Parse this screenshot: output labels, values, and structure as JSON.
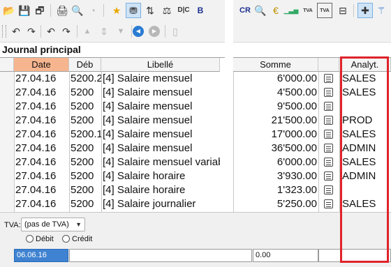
{
  "toolbar_row1": [
    {
      "icon": "open-folder-icon",
      "glyph": "📂"
    },
    {
      "icon": "save-icon",
      "glyph": "💾"
    },
    {
      "icon": "save-close-icon",
      "glyph": "🗗"
    },
    {
      "icon": "print-icon",
      "glyph": "🖨"
    },
    {
      "icon": "print-preview-icon",
      "glyph": "🔍"
    },
    {
      "icon": "clock-icon",
      "glyph": "◔"
    },
    {
      "icon": "star-icon",
      "glyph": "★"
    },
    {
      "icon": "filter-icon",
      "glyph": "⛃"
    },
    {
      "icon": "sort-icon",
      "glyph": "⇅"
    },
    {
      "icon": "balance-icon",
      "glyph": "⚖"
    },
    {
      "icon": "dc-icon",
      "glyph": "D|C"
    },
    {
      "icon": "bold-icon",
      "glyph": "B"
    },
    {
      "icon": "cr-icon",
      "glyph": "CR"
    },
    {
      "icon": "search-icon",
      "glyph": "🔍"
    },
    {
      "icon": "euro-icon",
      "glyph": "€"
    },
    {
      "icon": "bar-chart-icon",
      "glyph": "▁▃▅"
    },
    {
      "icon": "vat-icon",
      "glyph": "TVA"
    },
    {
      "icon": "vat-box-icon",
      "glyph": "TVA"
    },
    {
      "icon": "structure-icon",
      "glyph": "⊟"
    },
    {
      "icon": "add-icon",
      "glyph": "✚"
    },
    {
      "icon": "wand-icon",
      "glyph": "⚚"
    },
    {
      "icon": "pencil-icon",
      "glyph": "✎"
    }
  ],
  "toolbar_row2": [
    {
      "icon": "undo-icon",
      "glyph": "↶"
    },
    {
      "icon": "redo-icon",
      "glyph": "↷"
    },
    {
      "icon": "undo-list-icon",
      "glyph": "↶"
    },
    {
      "icon": "redo-list-icon",
      "glyph": "↷"
    },
    {
      "icon": "move-up-icon",
      "glyph": "▲"
    },
    {
      "icon": "move-both-icon",
      "glyph": "⇕"
    },
    {
      "icon": "move-down-icon",
      "glyph": "▼"
    },
    {
      "icon": "back-icon",
      "glyph": "◀"
    },
    {
      "icon": "forward-icon",
      "glyph": "▶"
    },
    {
      "icon": "info-icon",
      "glyph": "▯"
    }
  ],
  "journal": {
    "title": "Journal principal",
    "columns": {
      "date": "Date",
      "debit": "Déb",
      "label": "Libellé",
      "amount": "Somme",
      "analytic": "Analyt."
    },
    "rows": [
      {
        "date": "27.04.16",
        "debit": "5200.2",
        "label": "[4] Salaire mensuel",
        "amount": "6'000.00",
        "analytic": "SALES"
      },
      {
        "date": "27.04.16",
        "debit": "5200",
        "label": "[4] Salaire mensuel",
        "amount": "4'500.00",
        "analytic": "SALES"
      },
      {
        "date": "27.04.16",
        "debit": "5200",
        "label": "[4] Salaire mensuel",
        "amount": "9'500.00",
        "analytic": ""
      },
      {
        "date": "27.04.16",
        "debit": "5200",
        "label": "[4] Salaire mensuel",
        "amount": "21'500.00",
        "analytic": "PROD"
      },
      {
        "date": "27.04.16",
        "debit": "5200.1",
        "label": "[4] Salaire mensuel",
        "amount": "17'000.00",
        "analytic": "SALES"
      },
      {
        "date": "27.04.16",
        "debit": "5200",
        "label": "[4] Salaire mensuel",
        "amount": "36'500.00",
        "analytic": "ADMIN"
      },
      {
        "date": "27.04.16",
        "debit": "5200",
        "label": "[4] Salaire mensuel variab",
        "amount": "6'000.00",
        "analytic": "SALES"
      },
      {
        "date": "27.04.16",
        "debit": "5200",
        "label": "[4] Salaire horaire",
        "amount": "3'930.00",
        "analytic": "ADMIN"
      },
      {
        "date": "27.04.16",
        "debit": "5200",
        "label": "[4] Salaire horaire",
        "amount": "1'323.00",
        "analytic": ""
      },
      {
        "date": "27.04.16",
        "debit": "5200",
        "label": "[4] Salaire journalier",
        "amount": "5'250.00",
        "analytic": "SALES"
      }
    ]
  },
  "entry_form": {
    "vat_label": "TVA:",
    "vat_value": "(pas de TVA)",
    "radio_debit": "Débit",
    "radio_credit": "Crédit",
    "date_value": "06.06.16",
    "amount_value": "0.00"
  },
  "colors": {
    "sorted_header": "#f7b58f",
    "highlight_box": "#e0232b",
    "selection": "#3f82d1"
  }
}
